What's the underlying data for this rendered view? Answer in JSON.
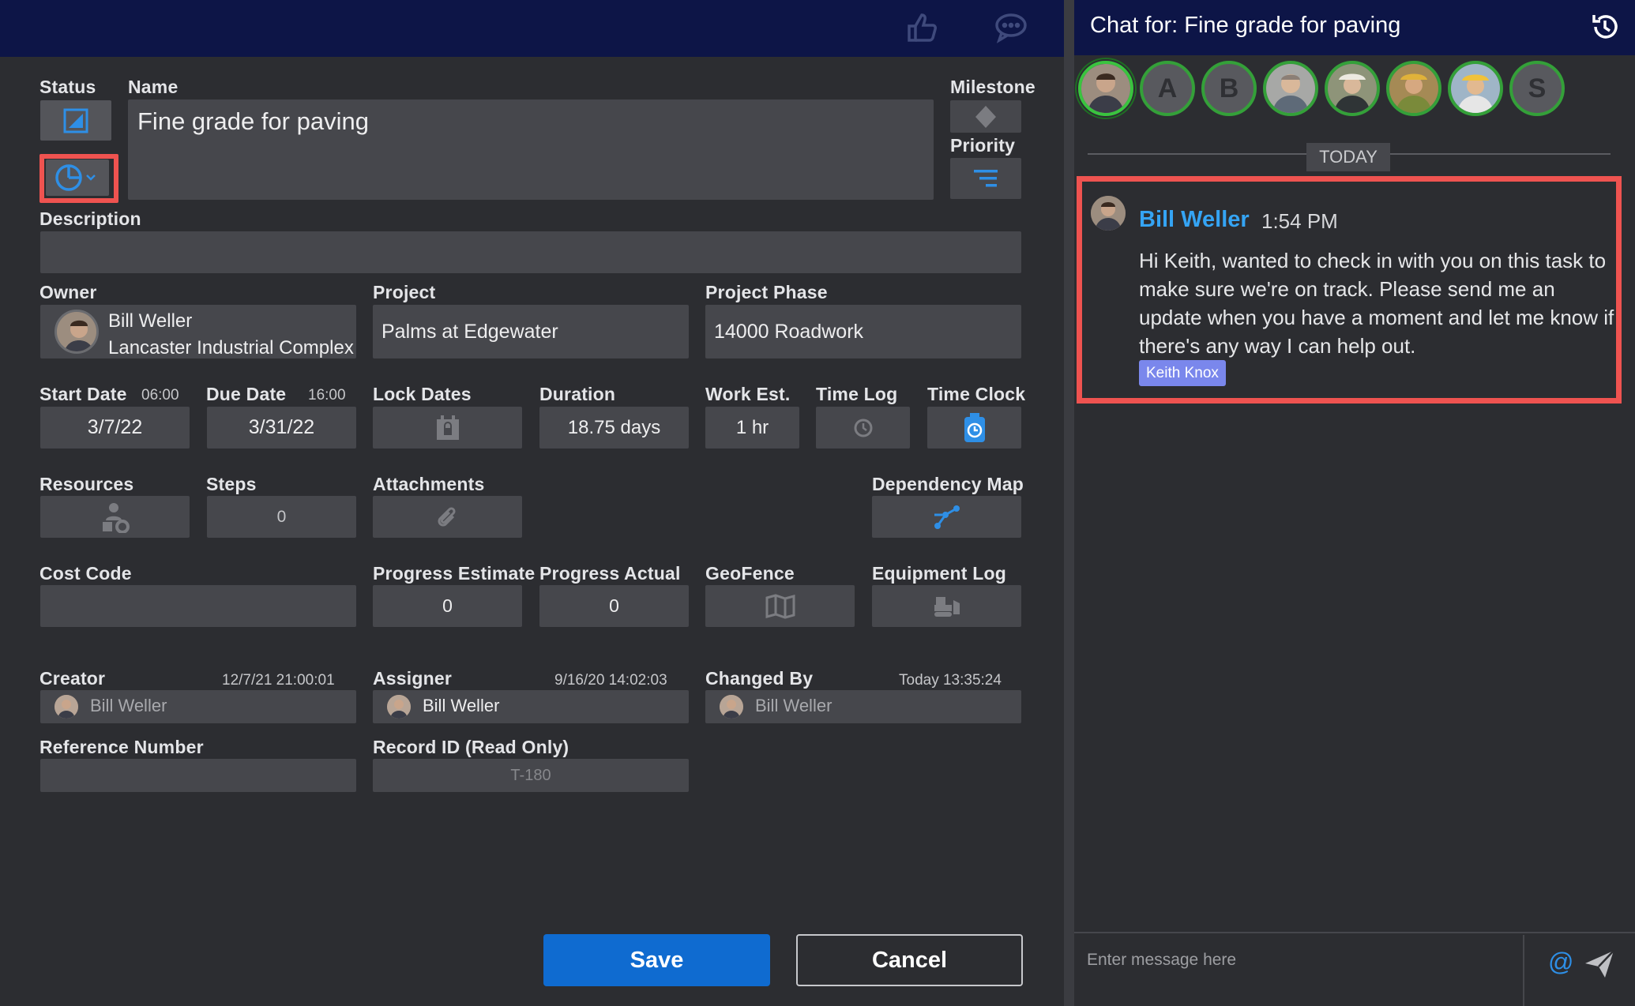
{
  "colors": {
    "header_bg": "#0d1547",
    "panel_bg": "#2c2d31",
    "field_bg": "#46474c",
    "accent_blue": "#2e8fe6",
    "save_blue": "#0f6bd0",
    "highlight_red": "#ef5350",
    "online_green": "#34a039",
    "mention_tag": "#7a87ec"
  },
  "toolbar": {
    "icons": [
      "thumbs-up-icon",
      "comment-icon"
    ]
  },
  "form": {
    "status_label": "Status",
    "name_label": "Name",
    "name_value": "Fine grade for paving",
    "milestone_label": "Milestone",
    "priority_label": "Priority",
    "description_label": "Description",
    "description_value": "",
    "owner_label": "Owner",
    "owner_name": "Bill Weller",
    "owner_company": "Lancaster Industrial Complex",
    "project_label": "Project",
    "project_value": "Palms at Edgewater",
    "phase_label": "Project Phase",
    "phase_value": "14000 Roadwork",
    "start_label": "Start Date",
    "start_time": "06:00",
    "start_value": "3/7/22",
    "due_label": "Due Date",
    "due_time": "16:00",
    "due_value": "3/31/22",
    "lock_label": "Lock Dates",
    "duration_label": "Duration",
    "duration_value": "18.75 days",
    "work_label": "Work Est.",
    "work_value": "1 hr",
    "timelog_label": "Time Log",
    "timeclock_label": "Time Clock",
    "resources_label": "Resources",
    "steps_label": "Steps",
    "steps_value": "0",
    "attachments_label": "Attachments",
    "dependency_label": "Dependency Map",
    "costcode_label": "Cost Code",
    "costcode_value": "",
    "prog_est_label": "Progress Estimate",
    "prog_est_value": "0",
    "prog_act_label": "Progress Actual",
    "prog_act_value": "0",
    "geofence_label": "GeoFence",
    "equipment_label": "Equipment Log",
    "creator_label": "Creator",
    "creator_ts": "12/7/21  21:00:01",
    "creator_name": "Bill Weller",
    "assigner_label": "Assigner",
    "assigner_ts": "9/16/20  14:02:03",
    "assigner_name": "Bill Weller",
    "changed_label": "Changed By",
    "changed_ts": "Today  13:35:24",
    "changed_name": "Bill Weller",
    "refnum_label": "Reference Number",
    "refnum_value": "",
    "record_label": "Record ID (Read Only)",
    "record_value": "T-180",
    "save_label": "Save",
    "cancel_label": "Cancel"
  },
  "chat": {
    "title": "Chat for: Fine grade for paving",
    "participants": [
      "photo",
      "A",
      "B",
      "photo",
      "photo",
      "photo",
      "photo",
      "S"
    ],
    "divider_label": "TODAY",
    "message": {
      "author": "Bill Weller",
      "time": "1:54 PM",
      "body": "Hi Keith, wanted to check in with you on this task to make sure we're on track. Please send me an update when you have a moment and let me know if there's any way I can help out.",
      "mention": "Keith Knox"
    },
    "composer_placeholder": "Enter message here",
    "composer_icons": [
      "at-mention-icon",
      "send-icon"
    ]
  }
}
